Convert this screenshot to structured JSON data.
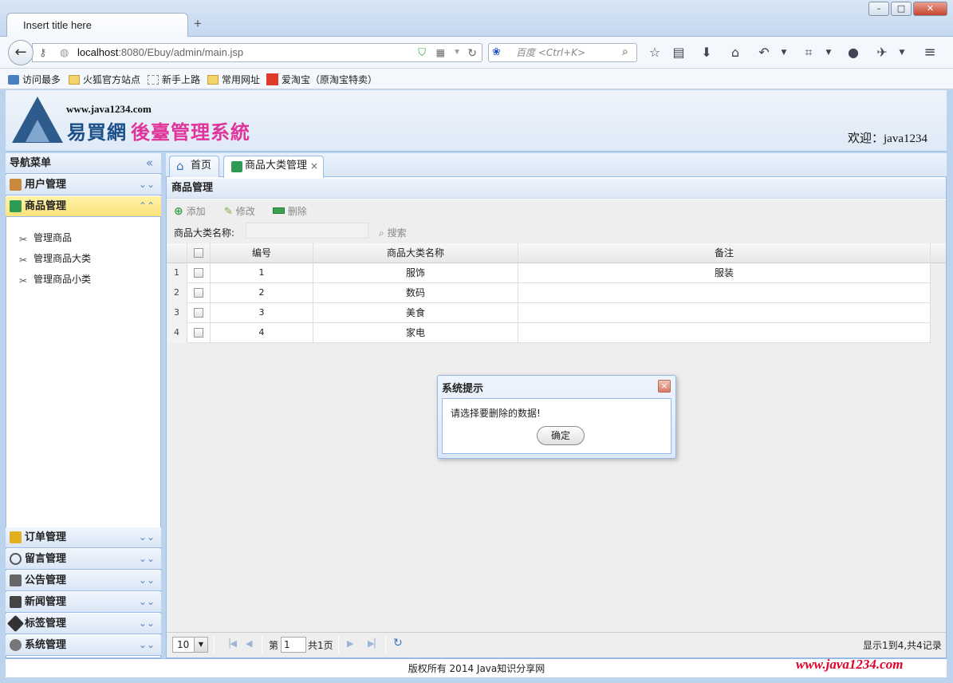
{
  "browser": {
    "tab_title": "Insert title here",
    "new_tab": "+",
    "url_host": "localhost",
    "url_path": ":8080/Ebuy/admin/main.jsp",
    "search_placeholder": "百度 <Ctrl+K>",
    "window_buttons": {
      "minimize": "–",
      "maximize": "□",
      "close": "✕"
    },
    "bookmarks": [
      "访问最多",
      "火狐官方站点",
      "新手上路",
      "常用网址",
      "爱淘宝（原淘宝特卖）"
    ]
  },
  "header": {
    "site": "www.java1234.com",
    "title_part1": "易買網",
    "title_part2": "後臺管理系統",
    "welcome": "欢迎：java1234"
  },
  "nav": {
    "title": "导航菜单",
    "collapse": "«",
    "sections": [
      {
        "label": "用户管理",
        "chevron": "⌄⌄",
        "color": "#c98a3c"
      },
      {
        "label": "商品管理",
        "chevron": "⌃⌃",
        "color": "#2f9a54"
      },
      {
        "label": "订单管理",
        "chevron": "⌄⌄",
        "color": "#e0b020"
      },
      {
        "label": "留言管理",
        "chevron": "⌄⌄",
        "color": "#555555"
      },
      {
        "label": "公告管理",
        "chevron": "⌄⌄",
        "color": "#666666"
      },
      {
        "label": "新闻管理",
        "chevron": "⌄⌄",
        "color": "#444444"
      },
      {
        "label": "标签管理",
        "chevron": "⌄⌄",
        "color": "#333333"
      },
      {
        "label": "系统管理",
        "chevron": "⌄⌄",
        "color": "#777777"
      }
    ],
    "sub_items": [
      "管理商品",
      "管理商品大类",
      "管理商品小类"
    ]
  },
  "tabs": [
    {
      "label": "首页"
    },
    {
      "label": "商品大类管理",
      "close": "×"
    }
  ],
  "panel": {
    "title": "商品管理",
    "toolbar": {
      "add": "添加",
      "edit": "修改",
      "delete": "删除"
    },
    "filter_label": "商品大类名称:",
    "filter_value": "",
    "search": "搜索"
  },
  "grid": {
    "columns": [
      "编号",
      "商品大类名称",
      "备注"
    ],
    "rows": [
      {
        "n": "1",
        "id": "1",
        "name": "服饰",
        "remark": "服装"
      },
      {
        "n": "2",
        "id": "2",
        "name": "数码",
        "remark": ""
      },
      {
        "n": "3",
        "id": "3",
        "name": "美食",
        "remark": ""
      },
      {
        "n": "4",
        "id": "4",
        "name": "家电",
        "remark": ""
      }
    ]
  },
  "pager": {
    "page_size": "10",
    "page_label_before": "第",
    "page_number": "1",
    "page_label_after": "共1页",
    "summary": "显示1到4,共4记录"
  },
  "footer": {
    "copyright": "版权所有 2014 Java知识分享网",
    "watermark": "www.java1234.com"
  },
  "dialog": {
    "title": "系统提示",
    "close": "×",
    "message": "请选择要删除的数据!",
    "ok": "确定"
  }
}
